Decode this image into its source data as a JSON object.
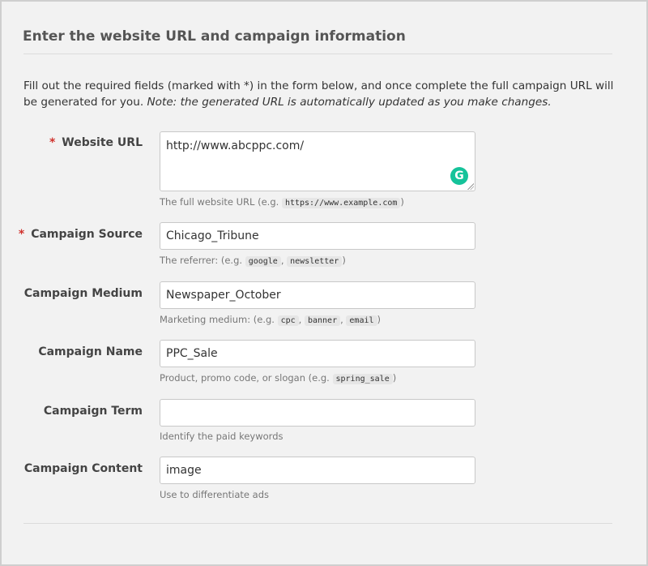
{
  "header": {
    "title": "Enter the website URL and campaign information"
  },
  "intro": {
    "text": "Fill out the required fields (marked with *) in the form below, and once complete the full campaign URL will be generated for you.",
    "note": "Note: the generated URL is automatically updated as you make changes."
  },
  "required_marker": "*",
  "fields": {
    "website_url": {
      "label": "Website URL",
      "value": "http://www.abcppc.com/",
      "help_prefix": "The full website URL (e.g.",
      "help_codes": [
        "https://www.example.com"
      ],
      "help_suffix": ")"
    },
    "campaign_source": {
      "label": "Campaign Source",
      "value": "Chicago_Tribune",
      "help_prefix": "The referrer: (e.g.",
      "help_codes": [
        "google",
        "newsletter"
      ],
      "help_suffix": ")"
    },
    "campaign_medium": {
      "label": "Campaign Medium",
      "value": "Newspaper_October",
      "help_prefix": "Marketing medium: (e.g.",
      "help_codes": [
        "cpc",
        "banner",
        "email"
      ],
      "help_suffix": ")"
    },
    "campaign_name": {
      "label": "Campaign Name",
      "value": "PPC_Sale",
      "help_prefix": "Product, promo code, or slogan (e.g.",
      "help_codes": [
        "spring_sale"
      ],
      "help_suffix": ")"
    },
    "campaign_term": {
      "label": "Campaign Term",
      "value": "",
      "help_prefix": "Identify the paid keywords"
    },
    "campaign_content": {
      "label": "Campaign Content",
      "value": "image",
      "help_prefix": "Use to differentiate ads"
    }
  },
  "grammarly": {
    "icon": "grammarly-icon",
    "glyph": "G",
    "color": "#15c39a"
  },
  "colors": {
    "required": "#d0322d"
  }
}
